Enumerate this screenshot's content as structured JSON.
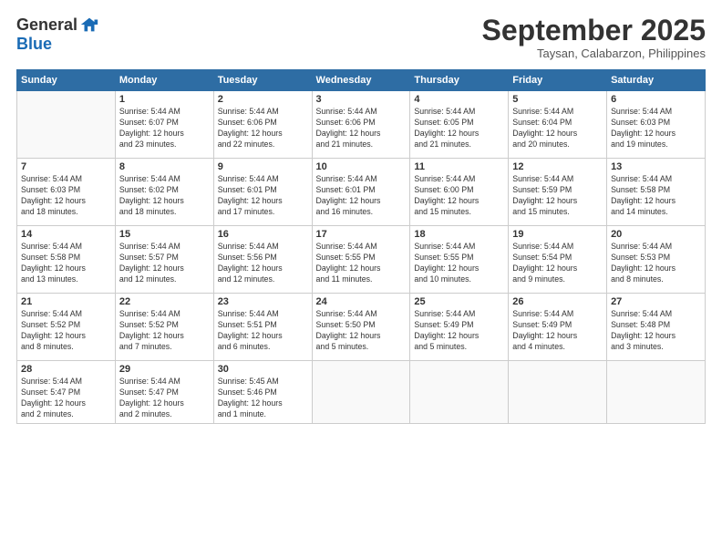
{
  "header": {
    "logo_line1": "General",
    "logo_line2": "Blue",
    "month": "September 2025",
    "location": "Taysan, Calabarzon, Philippines"
  },
  "weekdays": [
    "Sunday",
    "Monday",
    "Tuesday",
    "Wednesday",
    "Thursday",
    "Friday",
    "Saturday"
  ],
  "weeks": [
    [
      {
        "day": "",
        "info": ""
      },
      {
        "day": "1",
        "info": "Sunrise: 5:44 AM\nSunset: 6:07 PM\nDaylight: 12 hours\nand 23 minutes."
      },
      {
        "day": "2",
        "info": "Sunrise: 5:44 AM\nSunset: 6:06 PM\nDaylight: 12 hours\nand 22 minutes."
      },
      {
        "day": "3",
        "info": "Sunrise: 5:44 AM\nSunset: 6:06 PM\nDaylight: 12 hours\nand 21 minutes."
      },
      {
        "day": "4",
        "info": "Sunrise: 5:44 AM\nSunset: 6:05 PM\nDaylight: 12 hours\nand 21 minutes."
      },
      {
        "day": "5",
        "info": "Sunrise: 5:44 AM\nSunset: 6:04 PM\nDaylight: 12 hours\nand 20 minutes."
      },
      {
        "day": "6",
        "info": "Sunrise: 5:44 AM\nSunset: 6:03 PM\nDaylight: 12 hours\nand 19 minutes."
      }
    ],
    [
      {
        "day": "7",
        "info": "Sunrise: 5:44 AM\nSunset: 6:03 PM\nDaylight: 12 hours\nand 18 minutes."
      },
      {
        "day": "8",
        "info": "Sunrise: 5:44 AM\nSunset: 6:02 PM\nDaylight: 12 hours\nand 18 minutes."
      },
      {
        "day": "9",
        "info": "Sunrise: 5:44 AM\nSunset: 6:01 PM\nDaylight: 12 hours\nand 17 minutes."
      },
      {
        "day": "10",
        "info": "Sunrise: 5:44 AM\nSunset: 6:01 PM\nDaylight: 12 hours\nand 16 minutes."
      },
      {
        "day": "11",
        "info": "Sunrise: 5:44 AM\nSunset: 6:00 PM\nDaylight: 12 hours\nand 15 minutes."
      },
      {
        "day": "12",
        "info": "Sunrise: 5:44 AM\nSunset: 5:59 PM\nDaylight: 12 hours\nand 15 minutes."
      },
      {
        "day": "13",
        "info": "Sunrise: 5:44 AM\nSunset: 5:58 PM\nDaylight: 12 hours\nand 14 minutes."
      }
    ],
    [
      {
        "day": "14",
        "info": "Sunrise: 5:44 AM\nSunset: 5:58 PM\nDaylight: 12 hours\nand 13 minutes."
      },
      {
        "day": "15",
        "info": "Sunrise: 5:44 AM\nSunset: 5:57 PM\nDaylight: 12 hours\nand 12 minutes."
      },
      {
        "day": "16",
        "info": "Sunrise: 5:44 AM\nSunset: 5:56 PM\nDaylight: 12 hours\nand 12 minutes."
      },
      {
        "day": "17",
        "info": "Sunrise: 5:44 AM\nSunset: 5:55 PM\nDaylight: 12 hours\nand 11 minutes."
      },
      {
        "day": "18",
        "info": "Sunrise: 5:44 AM\nSunset: 5:55 PM\nDaylight: 12 hours\nand 10 minutes."
      },
      {
        "day": "19",
        "info": "Sunrise: 5:44 AM\nSunset: 5:54 PM\nDaylight: 12 hours\nand 9 minutes."
      },
      {
        "day": "20",
        "info": "Sunrise: 5:44 AM\nSunset: 5:53 PM\nDaylight: 12 hours\nand 8 minutes."
      }
    ],
    [
      {
        "day": "21",
        "info": "Sunrise: 5:44 AM\nSunset: 5:52 PM\nDaylight: 12 hours\nand 8 minutes."
      },
      {
        "day": "22",
        "info": "Sunrise: 5:44 AM\nSunset: 5:52 PM\nDaylight: 12 hours\nand 7 minutes."
      },
      {
        "day": "23",
        "info": "Sunrise: 5:44 AM\nSunset: 5:51 PM\nDaylight: 12 hours\nand 6 minutes."
      },
      {
        "day": "24",
        "info": "Sunrise: 5:44 AM\nSunset: 5:50 PM\nDaylight: 12 hours\nand 5 minutes."
      },
      {
        "day": "25",
        "info": "Sunrise: 5:44 AM\nSunset: 5:49 PM\nDaylight: 12 hours\nand 5 minutes."
      },
      {
        "day": "26",
        "info": "Sunrise: 5:44 AM\nSunset: 5:49 PM\nDaylight: 12 hours\nand 4 minutes."
      },
      {
        "day": "27",
        "info": "Sunrise: 5:44 AM\nSunset: 5:48 PM\nDaylight: 12 hours\nand 3 minutes."
      }
    ],
    [
      {
        "day": "28",
        "info": "Sunrise: 5:44 AM\nSunset: 5:47 PM\nDaylight: 12 hours\nand 2 minutes."
      },
      {
        "day": "29",
        "info": "Sunrise: 5:44 AM\nSunset: 5:47 PM\nDaylight: 12 hours\nand 2 minutes."
      },
      {
        "day": "30",
        "info": "Sunrise: 5:45 AM\nSunset: 5:46 PM\nDaylight: 12 hours\nand 1 minute."
      },
      {
        "day": "",
        "info": ""
      },
      {
        "day": "",
        "info": ""
      },
      {
        "day": "",
        "info": ""
      },
      {
        "day": "",
        "info": ""
      }
    ]
  ]
}
